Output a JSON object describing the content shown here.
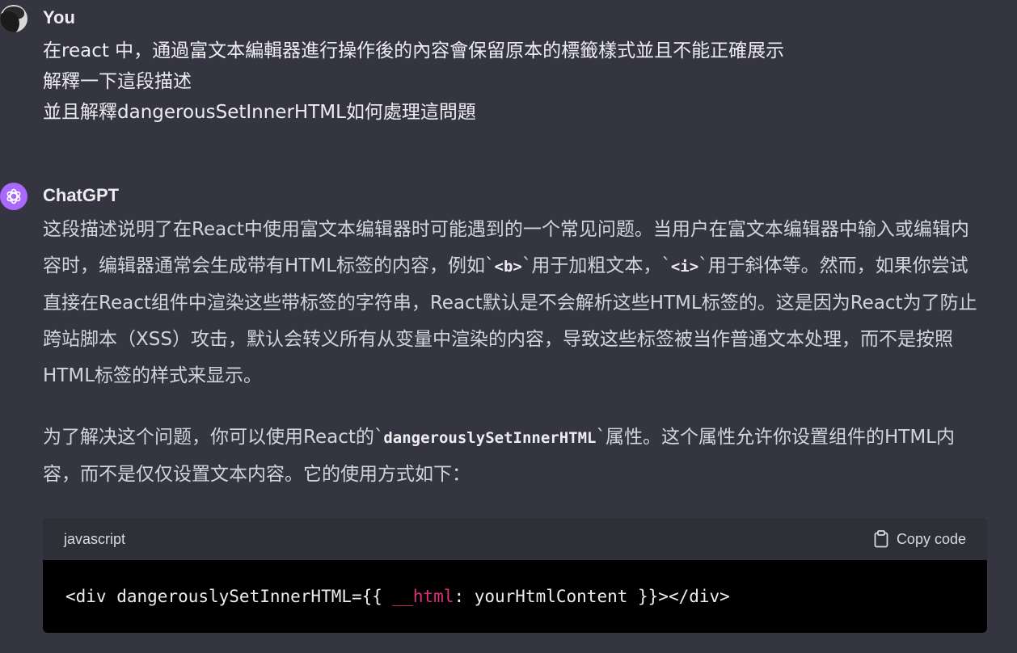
{
  "user": {
    "author": "You",
    "lines": [
      "在react 中，通過富文本編輯器進行操作後的內容會保留原本的標籤樣式並且不能正確展示",
      "解釋一下這段描述",
      "並且解釋dangerousSetInnerHTML如何處理這問題"
    ]
  },
  "assistant": {
    "author": "ChatGPT",
    "p1": {
      "t1": "这段描述说明了在React中使用富文本编辑器时可能遇到的一个常见问题。当用户在富文本编辑器中输入或编辑内容时，编辑器通常会生成带有HTML标签的内容，例如`",
      "c1": "<b>",
      "t2": "`用于加粗文本，`",
      "c2": "<i>",
      "t3": "`用于斜体等。然而，如果你尝试直接在React组件中渲染这些带标签的字符串，React默认是不会解析这些HTML标签的。这是因为React为了防止跨站脚本（XSS）攻击，默认会转义所有从变量中渲染的内容，导致这些标签被当作普通文本处理，而不是按照HTML标签的样式来显示。"
    },
    "p2": {
      "t1": "为了解决这个问题，你可以使用React的`",
      "c1": "dangerouslySetInnerHTML",
      "t2": "`属性。这个属性允许你设置组件的HTML内容，而不是仅仅设置文本内容。它的使用方式如下："
    },
    "code": {
      "language": "javascript",
      "copy_label": "Copy code",
      "copy_icon": "clipboard-icon",
      "tokens": {
        "a": "<div dangerouslySetInnerHTML={{ ",
        "key": "__html",
        "b": ": yourHtmlContent }}></div>"
      }
    }
  },
  "colors": {
    "background": "#343541",
    "assistant_avatar": "#ab68ff",
    "code_key": "#df3079"
  }
}
